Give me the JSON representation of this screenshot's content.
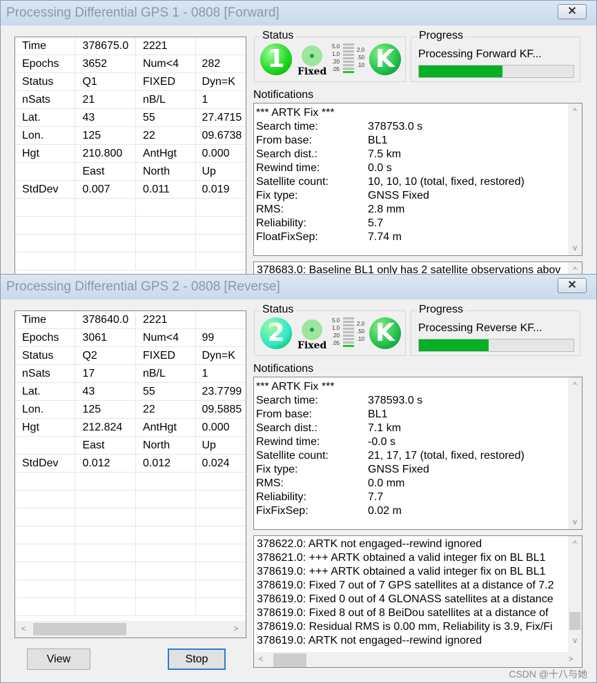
{
  "windows": [
    {
      "title": "Processing Differential GPS 1 - 0808 [Forward]",
      "close_icon": "close-icon",
      "grid": [
        [
          "Time",
          "378675.0",
          "2221",
          ""
        ],
        [
          "Epochs",
          "3652",
          "Num<4",
          "282"
        ],
        [
          "Status",
          "Q1",
          "FIXED",
          "Dyn=K"
        ],
        [
          "nSats",
          "21",
          "nB/L",
          "1"
        ],
        [
          "Lat.",
          "43",
          "55",
          "27.4715"
        ],
        [
          "Lon.",
          "125",
          "22",
          "09.6738"
        ],
        [
          "Hgt",
          "210.800",
          "AntHgt",
          "0.000"
        ],
        [
          "",
          "East",
          "North",
          "Up"
        ],
        [
          "StdDev",
          "0.007",
          "0.011",
          "0.019"
        ],
        [
          "",
          "",
          "",
          ""
        ],
        [
          "",
          "",
          "",
          ""
        ],
        [
          "",
          "",
          "",
          ""
        ],
        [
          "",
          "",
          "",
          ""
        ]
      ],
      "status": {
        "label": "Status",
        "pass_number": "1",
        "pass_color": "#1ed41e",
        "fix_label": "Fixed",
        "scale_left": [
          "5.0",
          "1.0",
          ".20",
          ".05"
        ],
        "scale_right": [
          "2.0",
          ".50",
          ".10"
        ],
        "mode": "K",
        "mode_color": "#1fbf4a"
      },
      "progress": {
        "label": "Progress",
        "text": "Processing Forward KF...",
        "percent": 54
      },
      "notifications": {
        "label": "Notifications",
        "header": "*** ARTK Fix ***",
        "items": [
          [
            "Search time:",
            "378753.0 s"
          ],
          [
            "From base:",
            "BL1"
          ],
          [
            "Search dist.:",
            "7.5 km"
          ],
          [
            "Rewind time:",
            "0.0 s"
          ],
          [
            "Satellite count:",
            "10, 10, 10  (total, fixed, restored)"
          ],
          [
            "Fix type:",
            "GNSS Fixed"
          ],
          [
            "RMS:",
            "2.8 mm"
          ],
          [
            "Reliability:",
            "5.7"
          ],
          [
            "FloatFixSep:",
            "7.74 m"
          ]
        ]
      },
      "log": [
        "378683.0: Baseline BL1 only has 2 satellite observations abov"
      ]
    },
    {
      "title": "Processing Differential GPS 2 - 0808 [Reverse]",
      "close_icon": "close-icon",
      "grid": [
        [
          "Time",
          "378640.0",
          "2221",
          ""
        ],
        [
          "Epochs",
          "3061",
          "Num<4",
          "99"
        ],
        [
          "Status",
          "Q2",
          "FIXED",
          "Dyn=K"
        ],
        [
          "nSats",
          "17",
          "nB/L",
          "1"
        ],
        [
          "Lat.",
          "43",
          "55",
          "23.7799"
        ],
        [
          "Lon.",
          "125",
          "22",
          "09.5885"
        ],
        [
          "Hgt",
          "212.824",
          "AntHgt",
          "0.000"
        ],
        [
          "",
          "East",
          "North",
          "Up"
        ],
        [
          "StdDev",
          "0.012",
          "0.012",
          "0.024"
        ],
        [
          "",
          "",
          "",
          ""
        ],
        [
          "",
          "",
          "",
          ""
        ],
        [
          "",
          "",
          "",
          ""
        ],
        [
          "",
          "",
          "",
          ""
        ],
        [
          "",
          "",
          "",
          ""
        ],
        [
          "",
          "",
          "",
          ""
        ],
        [
          "",
          "",
          "",
          ""
        ],
        [
          "",
          "",
          "",
          ""
        ]
      ],
      "status": {
        "label": "Status",
        "pass_number": "2",
        "pass_color": "#2ee6c8",
        "fix_label": "Fixed",
        "scale_left": [
          "5.0",
          "1.0",
          ".20",
          ".05"
        ],
        "scale_right": [
          "2.0",
          ".50",
          ".10"
        ],
        "mode": "K",
        "mode_color": "#1fbf4a"
      },
      "progress": {
        "label": "Progress",
        "text": "Processing Reverse KF...",
        "percent": 45
      },
      "notifications": {
        "label": "Notifications",
        "header": "*** ARTK Fix ***",
        "items": [
          [
            "Search time:",
            "378593.0 s"
          ],
          [
            "From base:",
            "BL1"
          ],
          [
            "Search dist.:",
            "7.1 km"
          ],
          [
            "Rewind time:",
            "-0.0 s"
          ],
          [
            "Satellite count:",
            "21, 17, 17  (total, fixed, restored)"
          ],
          [
            "Fix type:",
            "GNSS Fixed"
          ],
          [
            "RMS:",
            "0.0 mm"
          ],
          [
            "Reliability:",
            "7.7"
          ],
          [
            "FixFixSep:",
            "0.02 m"
          ]
        ]
      },
      "log": [
        "378622.0:   ARTK not engaged--rewind ignored",
        "378621.0: +++ ARTK obtained a valid integer fix on BL BL1",
        "378619.0: +++ ARTK obtained a valid integer fix on BL BL1",
        "378619.0:   Fixed 7 out of 7 GPS satellites at a distance of 7.2",
        "378619.0:   Fixed 0 out of 4 GLONASS satellites at a distance",
        "378619.0:   Fixed 8 out of 8 BeiDou satellites at a distance of",
        "378619.0:   Residual RMS is 0.00 mm, Reliability is 3.9, Fix/Fi",
        "378619.0:   ARTK not engaged--rewind ignored"
      ],
      "buttons": {
        "view": "View",
        "stop": "Stop"
      }
    }
  ],
  "watermark": "CSDN @十八与她"
}
